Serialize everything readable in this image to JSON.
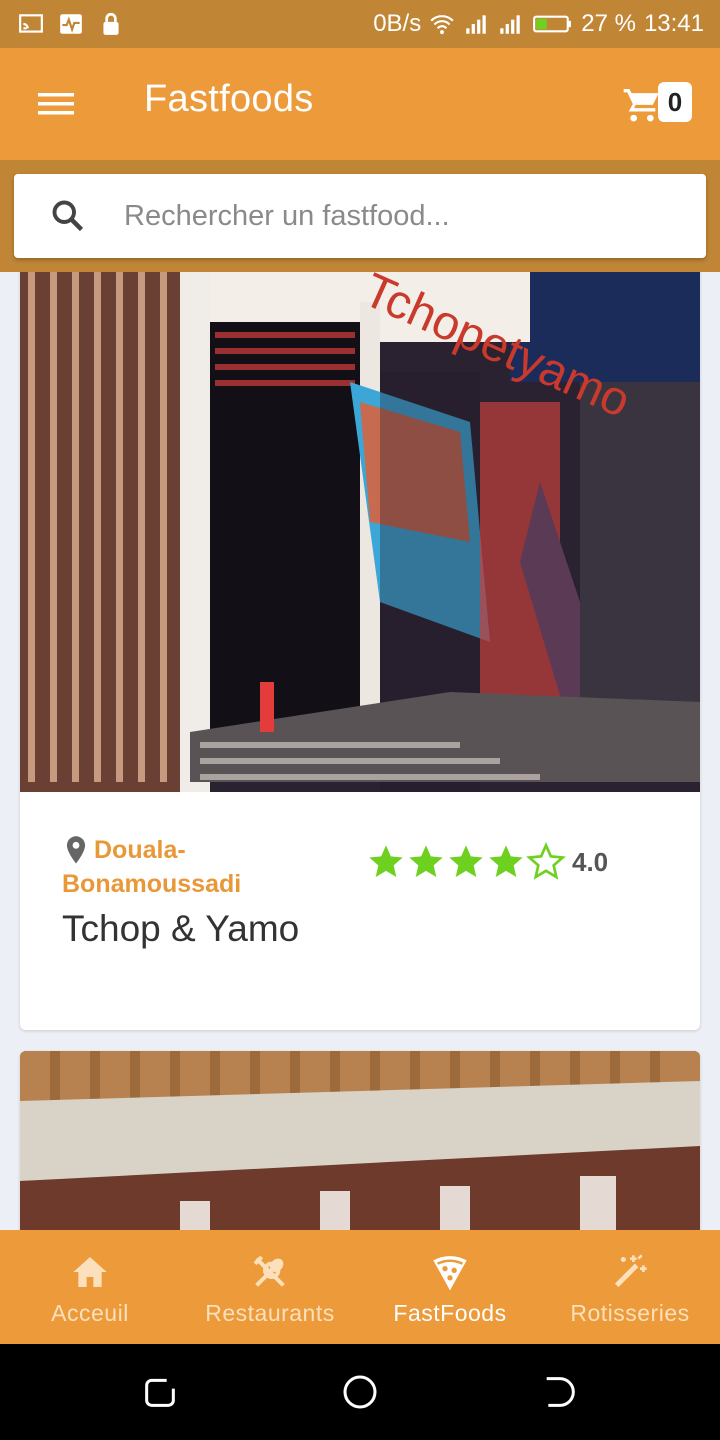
{
  "status_bar": {
    "speed": "0B/s",
    "battery": "27 %",
    "time": "13:41",
    "icons": [
      "screen-cast-icon",
      "activity-icon",
      "lock-icon",
      "wifi-icon",
      "signal-icon",
      "battery-icon"
    ]
  },
  "app_bar": {
    "title": "Fastfoods",
    "cart_count": "0",
    "accent": "#ec9a3a"
  },
  "search": {
    "placeholder": "Rechercher un fastfood..."
  },
  "cards": [
    {
      "location_line1": "Douala-",
      "location_line2": "Bonamoussadi",
      "name": "Tchop & Yamo",
      "rating": 4,
      "rating_max": 5,
      "rating_label": "4.0",
      "sign_text": "Tchopetyamo"
    }
  ],
  "bottom_nav": {
    "items": [
      {
        "label": "Acceuil",
        "icon": "home-icon"
      },
      {
        "label": "Restaurants",
        "icon": "utensils-icon"
      },
      {
        "label": "FastFoods",
        "icon": "pizza-icon"
      },
      {
        "label": "Rotisseries",
        "icon": "magic-wand-icon"
      }
    ],
    "active": "FastFoods"
  },
  "colors": {
    "status_bar": "#c08636",
    "accent": "#ec9a3a",
    "location": "#e89838",
    "star": "#6ed11f"
  }
}
